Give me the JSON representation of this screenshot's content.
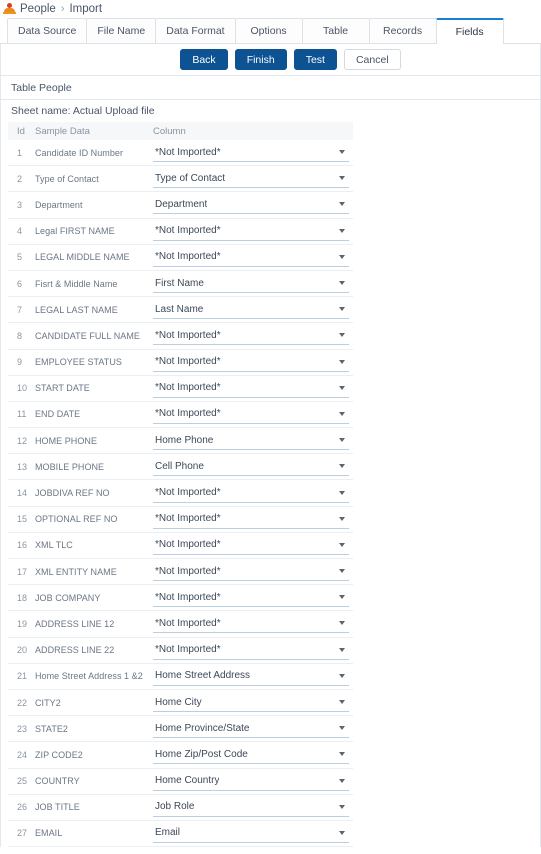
{
  "breadcrumb": {
    "icon": "person-icon",
    "parent": "People",
    "separator": "›",
    "current": "Import"
  },
  "tabs": [
    {
      "label": "Data Source",
      "active": false
    },
    {
      "label": "File Name",
      "active": false
    },
    {
      "label": "Data Format",
      "active": false
    },
    {
      "label": "Options",
      "active": false
    },
    {
      "label": "Table",
      "active": false
    },
    {
      "label": "Records",
      "active": false
    },
    {
      "label": "Fields",
      "active": true
    }
  ],
  "buttons": [
    {
      "label": "Back",
      "style": "primary"
    },
    {
      "label": "Finish",
      "style": "primary"
    },
    {
      "label": "Test",
      "style": "primary"
    },
    {
      "label": "Cancel",
      "style": "ghost"
    }
  ],
  "table_title": "Table People",
  "sheet_name": "Sheet name: Actual Upload file",
  "grid": {
    "headers": {
      "id": "Id",
      "sample": "Sample Data",
      "column": "Column"
    },
    "rows": [
      {
        "id": "1",
        "sample": "Candidate ID Number",
        "column": "*Not Imported*"
      },
      {
        "id": "2",
        "sample": "Type of Contact",
        "column": "Type of Contact"
      },
      {
        "id": "3",
        "sample": "Department",
        "column": "Department"
      },
      {
        "id": "4",
        "sample": "Legal FIRST NAME",
        "column": "*Not Imported*"
      },
      {
        "id": "5",
        "sample": "LEGAL MIDDLE NAME",
        "column": "*Not Imported*"
      },
      {
        "id": "6",
        "sample": "Fisrt & Middle Name",
        "column": "First Name"
      },
      {
        "id": "7",
        "sample": "LEGAL LAST NAME",
        "column": "Last Name"
      },
      {
        "id": "8",
        "sample": "CANDIDATE FULL NAME",
        "column": "*Not Imported*"
      },
      {
        "id": "9",
        "sample": "EMPLOYEE STATUS",
        "column": "*Not Imported*"
      },
      {
        "id": "10",
        "sample": "START DATE",
        "column": "*Not Imported*"
      },
      {
        "id": "11",
        "sample": "END DATE",
        "column": "*Not Imported*"
      },
      {
        "id": "12",
        "sample": "HOME PHONE",
        "column": "Home Phone"
      },
      {
        "id": "13",
        "sample": "MOBILE PHONE",
        "column": "Cell Phone"
      },
      {
        "id": "14",
        "sample": "JOBDIVA REF NO",
        "column": "*Not Imported*"
      },
      {
        "id": "15",
        "sample": "OPTIONAL REF NO",
        "column": "*Not Imported*"
      },
      {
        "id": "16",
        "sample": "XML TLC",
        "column": "*Not Imported*"
      },
      {
        "id": "17",
        "sample": "XML ENTITY NAME",
        "column": "*Not Imported*"
      },
      {
        "id": "18",
        "sample": "JOB COMPANY",
        "column": "*Not Imported*"
      },
      {
        "id": "19",
        "sample": "ADDRESS LINE 12",
        "column": "*Not Imported*"
      },
      {
        "id": "20",
        "sample": "ADDRESS LINE 22",
        "column": "*Not Imported*"
      },
      {
        "id": "21",
        "sample": "Home Street Address 1 &2",
        "column": "Home Street Address"
      },
      {
        "id": "22",
        "sample": "CITY2",
        "column": "Home City"
      },
      {
        "id": "23",
        "sample": "STATE2",
        "column": "Home Province/State"
      },
      {
        "id": "24",
        "sample": "ZIP CODE2",
        "column": "Home Zip/Post Code"
      },
      {
        "id": "25",
        "sample": "COUNTRY",
        "column": "Home Country"
      },
      {
        "id": "26",
        "sample": "JOB TITLE",
        "column": "Job Role"
      },
      {
        "id": "27",
        "sample": "EMAIL",
        "column": "Email"
      }
    ]
  },
  "colors": {
    "primary_button": "#0d5293",
    "active_tab_border": "#1d7fd0",
    "select_underline": "#b9cfe2",
    "header_row_bg": "#f6f7f9",
    "icon_orange": "#e88a1c"
  }
}
